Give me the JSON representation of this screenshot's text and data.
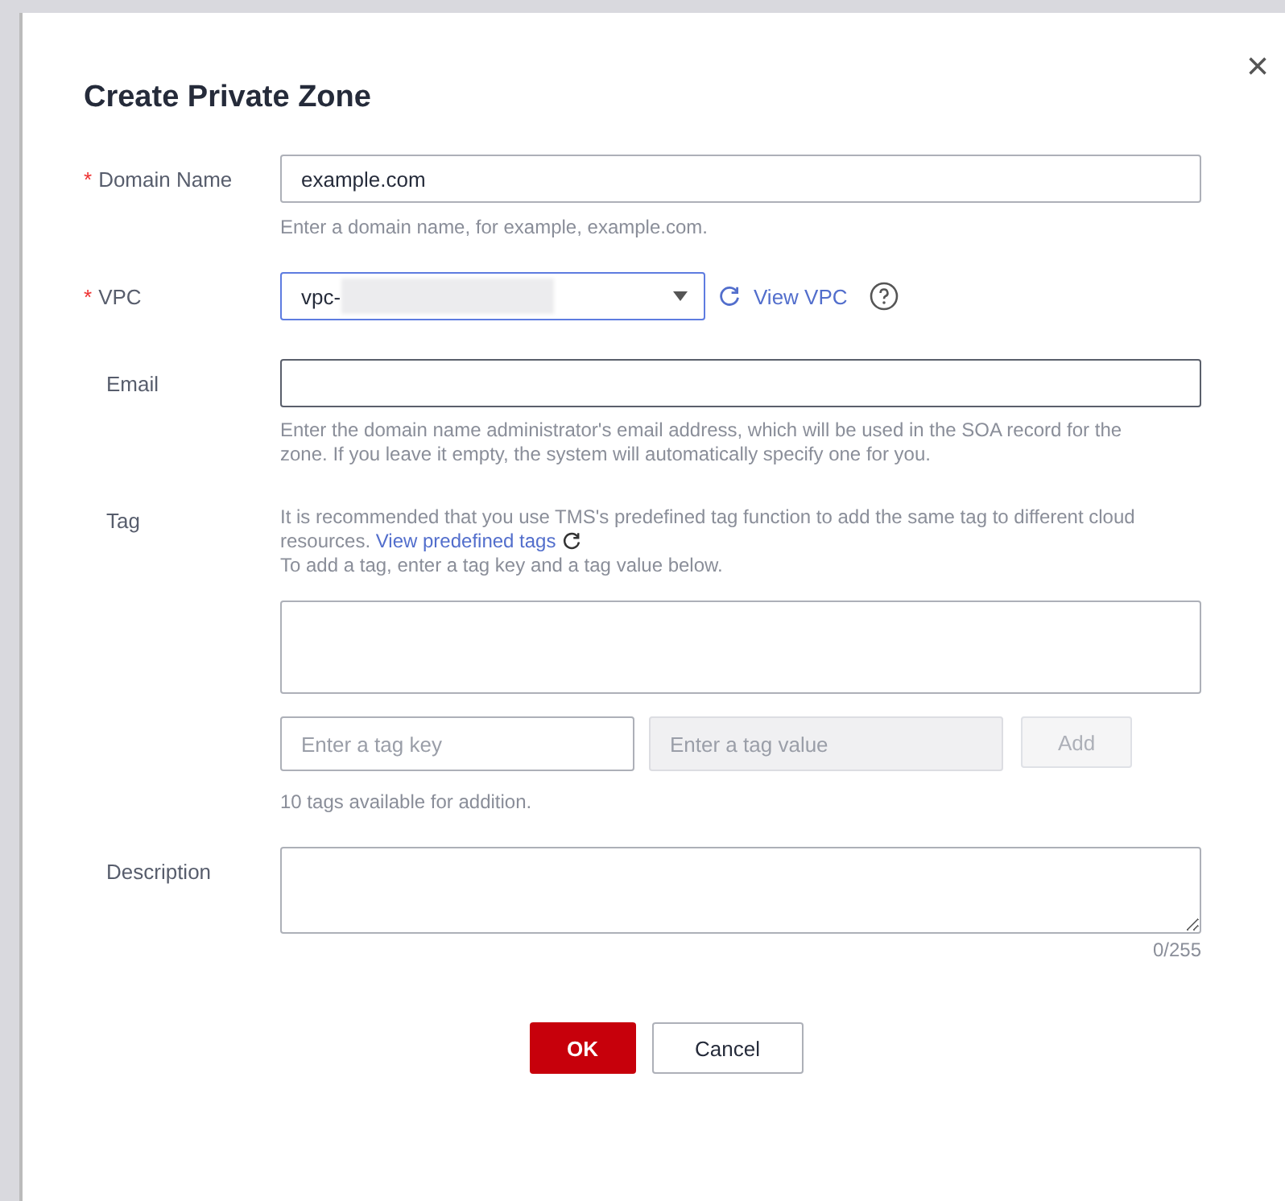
{
  "dialog": {
    "title": "Create Private Zone",
    "close": "×"
  },
  "fields": [
    {
      "kind": "text",
      "label": "Domain Name",
      "required_mark": "*",
      "value": "example.com",
      "hint": "Enter a domain name, for example, example.com."
    },
    {
      "kind": "select",
      "label": "VPC",
      "required_mark": "*",
      "value": "vpc-",
      "redacted": true,
      "link": "View VPC"
    },
    {
      "kind": "text",
      "label": "Email",
      "focused": true,
      "hint": "Enter the domain name administrator's email address, which will be used in the SOA record for the zone. If you leave it empty, the system will automatically specify one for you."
    },
    {
      "kind": "tags",
      "label": "Tag",
      "intro": "It is recommended that you use TMS's predefined tag function to add the same tag to different cloud resources.",
      "link": "View predefined tags",
      "intro2": "To add a tag, enter a tag key and a tag value below.",
      "key_placeholder": "Enter a tag key",
      "value_placeholder": "Enter a tag value",
      "value_disabled": true,
      "add": "Add",
      "add_disabled": true,
      "hint": "10 tags available for addition."
    },
    {
      "kind": "textarea",
      "label": "Description",
      "counter": "0/255"
    }
  ],
  "buttons": [
    {
      "label": "OK",
      "primary": true
    },
    {
      "label": "Cancel",
      "primary": false
    }
  ]
}
